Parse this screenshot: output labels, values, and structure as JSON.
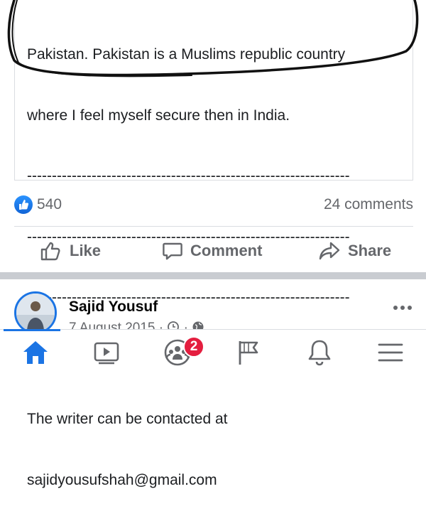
{
  "quoted_post": {
    "lines": [
      "Pakistan.  Pakistan is a Muslims republic country",
      "where I feel myself secure then in India.",
      "-----------------------------------------------------------------",
      "-----------------------------------------------------------------",
      "-----------------------------------------------------------------",
      "------------------------",
      "The writer can be contacted at",
      "sajidyousufshah@gmail.com"
    ]
  },
  "reactions": {
    "like_count": "540",
    "comments_label": "24 comments"
  },
  "actions": {
    "like_label": "Like",
    "comment_label": "Comment",
    "share_label": "Share"
  },
  "next_post": {
    "author": "Sajid Yousuf",
    "date": "7 August 2015 · ",
    "more_icon": "ellipsis-icon"
  },
  "tab_bar": {
    "tabs": [
      "home-icon",
      "watch-icon",
      "groups-icon",
      "pages-flag-icon",
      "notifications-bell-icon",
      "menu-icon"
    ],
    "groups_badge": "2",
    "active": "home"
  },
  "colors": {
    "accent": "#1b74e4",
    "badge": "#e41e3f",
    "secondary_text": "#65676b"
  }
}
